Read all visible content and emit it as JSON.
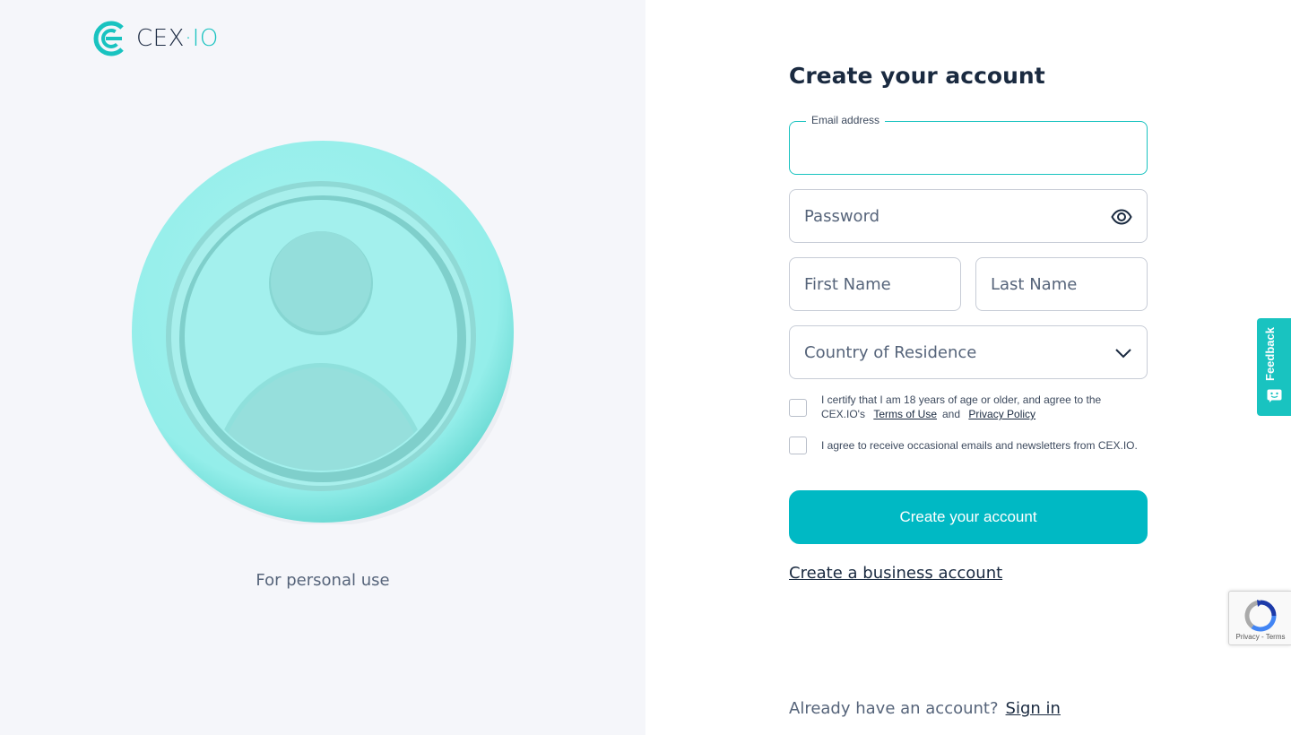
{
  "brand": {
    "cex": "CEX",
    "dot": "·",
    "io": "IO",
    "accent": "#19c3c0"
  },
  "hero": {
    "caption": "For personal use"
  },
  "form": {
    "title": "Create your account",
    "email": {
      "label": "Email address",
      "value": ""
    },
    "password": {
      "placeholder": "Password"
    },
    "first_name": {
      "placeholder": "First Name"
    },
    "last_name": {
      "placeholder": "Last Name"
    },
    "country": {
      "placeholder": "Country of Residence"
    },
    "consent_age": {
      "text_before": "I certify that I am 18 years of age or older, and agree to the CEX.IO's",
      "terms_link": "Terms of Use",
      "joiner": "and",
      "privacy_link": "Privacy Policy",
      "checked": false
    },
    "consent_news": {
      "text": "I agree to receive occasional emails and newsletters from CEX.IO.",
      "checked": false
    },
    "submit_label": "Create your account",
    "business_link": "Create a business account",
    "signin_prompt": "Already have an account?",
    "signin_link": "Sign in"
  },
  "feedback_tab": {
    "label": "Feedback"
  },
  "recaptcha": {
    "privacy": "Privacy",
    "separator": "-",
    "terms": "Terms"
  }
}
